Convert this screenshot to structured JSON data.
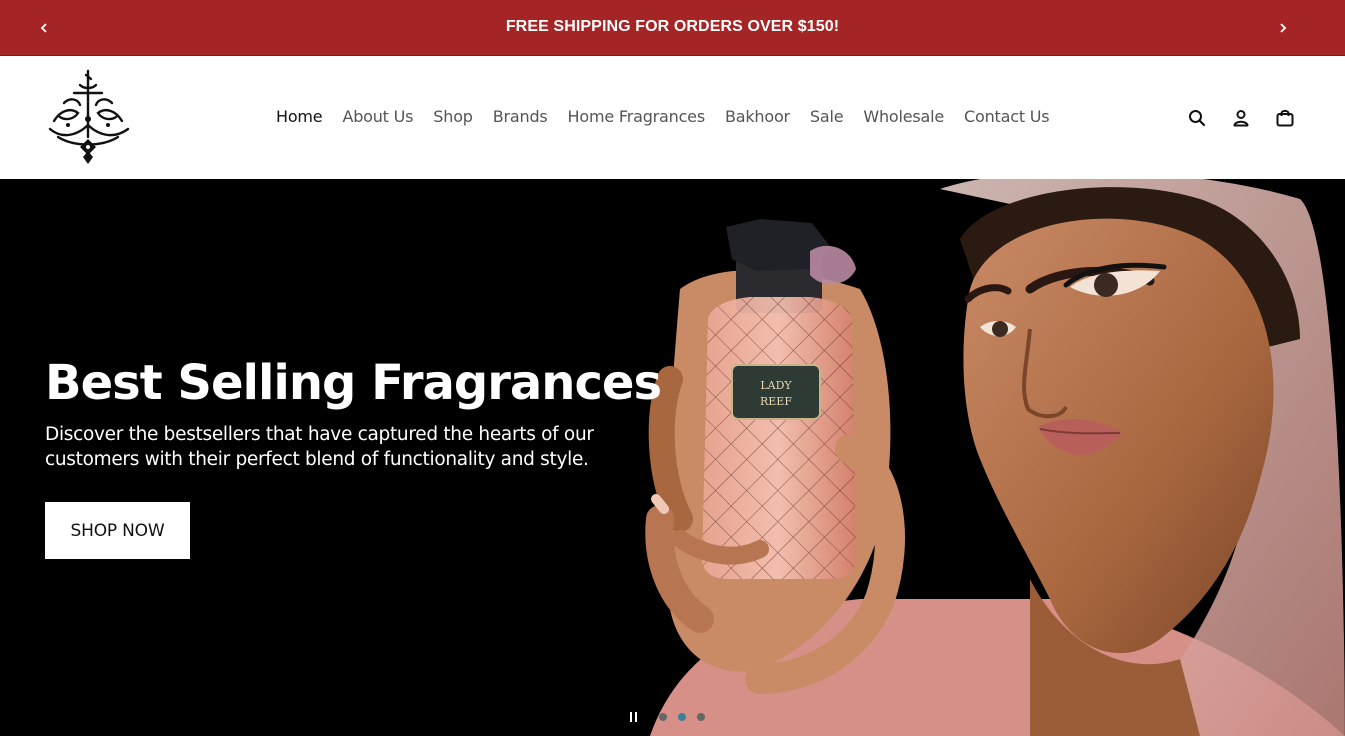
{
  "announcement": {
    "text": "FREE SHIPPING FOR ORDERS OVER $150!",
    "prev_icon": "chevron-left-icon",
    "next_icon": "chevron-right-icon",
    "background": "#a52426"
  },
  "header": {
    "logo": "calligraphy-logo",
    "nav": [
      {
        "label": "Home",
        "active": true
      },
      {
        "label": "About Us"
      },
      {
        "label": "Shop"
      },
      {
        "label": "Brands"
      },
      {
        "label": "Home Fragrances"
      },
      {
        "label": "Bakhoor"
      },
      {
        "label": "Sale"
      },
      {
        "label": "Wholesale"
      },
      {
        "label": "Contact Us"
      }
    ],
    "icons": [
      "search-icon",
      "account-icon",
      "cart-icon"
    ]
  },
  "hero": {
    "title": "Best Selling Fragrances",
    "subtitle": "Discover the bestsellers that have captured the hearts of our customers with their perfect blend of functionality and style.",
    "cta_label": "SHOP NOW",
    "bottle_label_line1": "LADY",
    "bottle_label_line2": "REEF",
    "slides_count": 3,
    "active_slide": 2,
    "pause_icon": "pause-icon"
  }
}
